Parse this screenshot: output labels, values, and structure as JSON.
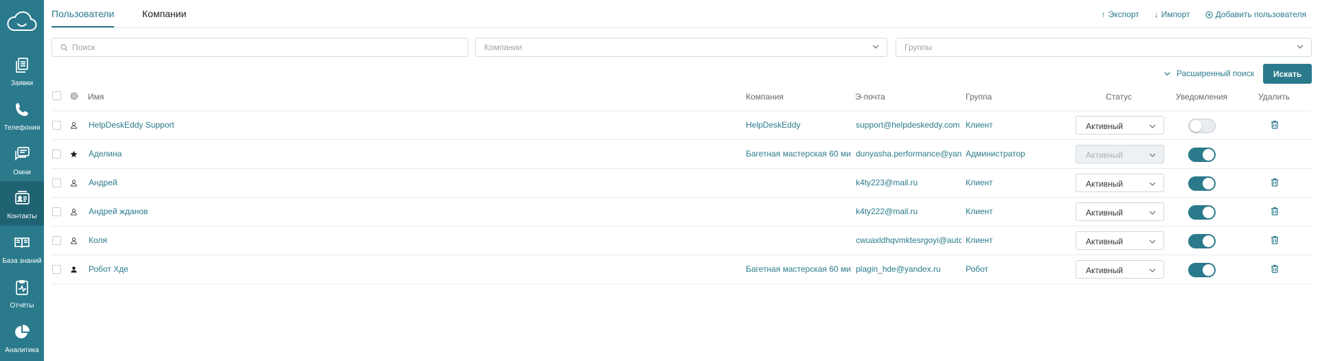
{
  "sidebar": {
    "logo_icon": "cloud-icon",
    "items": [
      {
        "label": "Заявки",
        "icon": "documents-icon",
        "active": false
      },
      {
        "label": "Телефония",
        "icon": "phone-icon",
        "active": false
      },
      {
        "label": "Омни",
        "icon": "chat-icon",
        "active": false
      },
      {
        "label": "Контакты",
        "icon": "contacts-icon",
        "active": true
      },
      {
        "label": "База знаний",
        "icon": "book-icon",
        "active": false
      },
      {
        "label": "Отчёты",
        "icon": "report-icon",
        "active": false
      },
      {
        "label": "Аналитика",
        "icon": "pie-chart-icon",
        "active": false
      }
    ]
  },
  "tabs": [
    {
      "label": "Пользователи",
      "active": true
    },
    {
      "label": "Компании",
      "active": false
    }
  ],
  "actions": {
    "export": "Экспорт",
    "import": "Импорт",
    "add_user": "Добавить пользователя"
  },
  "filters": {
    "search_placeholder": "Поиск",
    "companies_placeholder": "Компании",
    "groups_placeholder": "Группы"
  },
  "advanced_search": "Расширенный поиск",
  "search_button": "Искать",
  "columns": {
    "name": "Имя",
    "company": "Компания",
    "email": "Э-почта",
    "group": "Группа",
    "status": "Статус",
    "notifications": "Уведомления",
    "delete": "Удалить"
  },
  "rows": [
    {
      "name": "HelpDeskEddy Support",
      "type_icon": "user-outline-icon",
      "company": "HelpDeskEddy",
      "email": "support@helpdeskeddy.com",
      "group": "Клиент",
      "status": "Активный",
      "status_disabled": false,
      "notifications_on": false,
      "deletable": true
    },
    {
      "name": "Аделина",
      "type_icon": "star-icon",
      "company": "Багетная мастерская 60 ми",
      "email": "dunyasha.performance@yan",
      "group": "Администратор",
      "status": "Активный",
      "status_disabled": true,
      "notifications_on": true,
      "deletable": false
    },
    {
      "name": "Андрей",
      "type_icon": "user-outline-icon",
      "company": "",
      "email": "k4ty223@mail.ru",
      "group": "Клиент",
      "status": "Активный",
      "status_disabled": false,
      "notifications_on": true,
      "deletable": true
    },
    {
      "name": "Андрей жданов",
      "type_icon": "user-outline-icon",
      "company": "",
      "email": "k4ty222@mail.ru",
      "group": "Клиент",
      "status": "Активный",
      "status_disabled": false,
      "notifications_on": true,
      "deletable": true
    },
    {
      "name": "Коля",
      "type_icon": "user-outline-icon",
      "company": "",
      "email": "cwuaxldhqvmktesrgoyi@autc",
      "group": "Клиент",
      "status": "Активный",
      "status_disabled": false,
      "notifications_on": true,
      "deletable": true
    },
    {
      "name": "Робот Хде",
      "type_icon": "user-filled-icon",
      "company": "Багетная мастерская 60 ми",
      "email": "plagin_hde@yandex.ru",
      "group": "Робот",
      "status": "Активный",
      "status_disabled": false,
      "notifications_on": true,
      "deletable": true
    }
  ],
  "colors": {
    "accent": "#2a7a8c",
    "sidebar_bg": "#2a7a8c",
    "sidebar_active": "#1f6373"
  }
}
